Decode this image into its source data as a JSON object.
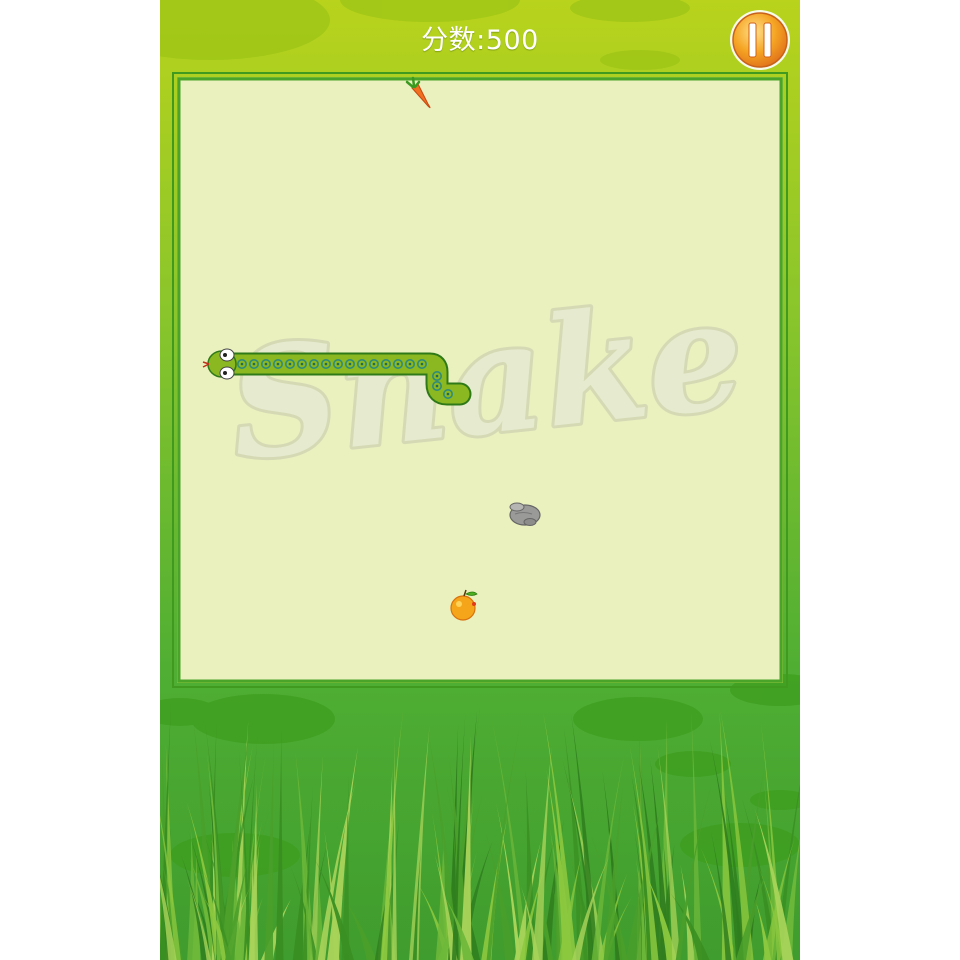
{
  "game": {
    "score_label": "分数",
    "score_separator": ":",
    "score_value": "500",
    "watermark_text": "Snake"
  },
  "hud": {
    "pause_button": "pause-icon"
  },
  "items": {
    "carrot": "carrot-icon",
    "stone": "stone-icon",
    "fruit": "orange-fruit-icon"
  },
  "colors": {
    "board_fill": "#eaf0be",
    "board_border": "#3f9a1f",
    "snake_body": "#8bb820",
    "snake_pattern": "#2f8c7a",
    "pause_orange": "#f29a1c"
  }
}
